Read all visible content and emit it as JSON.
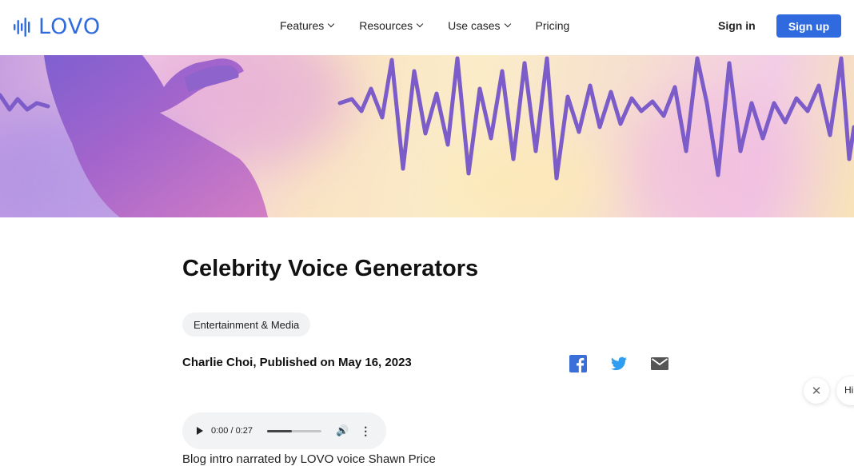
{
  "nav": {
    "logo_text": "LOVO",
    "items": [
      {
        "label": "Features",
        "has_dropdown": true
      },
      {
        "label": "Resources",
        "has_dropdown": true
      },
      {
        "label": "Use cases",
        "has_dropdown": true
      },
      {
        "label": "Pricing",
        "has_dropdown": false
      }
    ],
    "signin_label": "Sign in",
    "signup_label": "Sign up"
  },
  "colors": {
    "brand": "#2f6bdf",
    "wave": "#7b5cc9"
  },
  "article": {
    "title": "Celebrity Voice Generators",
    "tag": "Entertainment & Media",
    "byline": "Charlie Choi, Published on May 16, 2023",
    "share_icons": [
      "facebook-icon",
      "twitter-icon",
      "email-icon"
    ],
    "audio": {
      "time": "0:00 / 0:27",
      "progress": 0.45
    },
    "caption": "Blog intro narrated by LOVO voice Shawn Price"
  },
  "chat": {
    "close_symbol": "✕",
    "bubble_text": "Hi."
  }
}
